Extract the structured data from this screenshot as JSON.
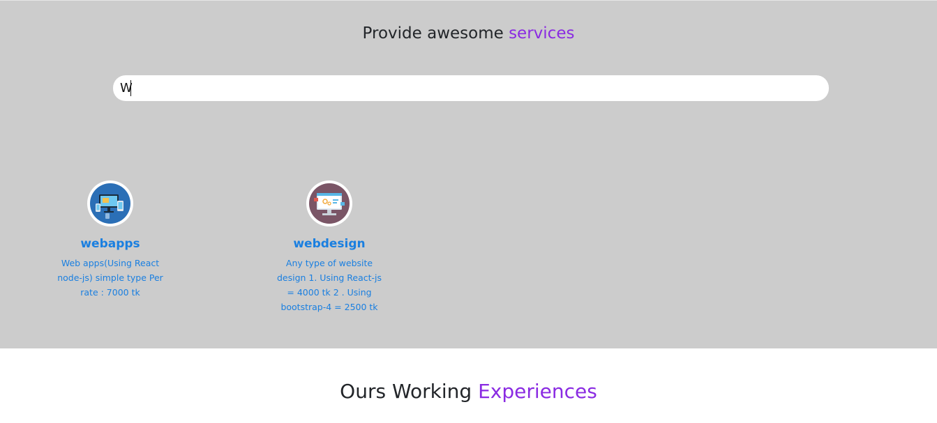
{
  "services": {
    "title_prefix": "Provide awesome",
    "title_accent": "services",
    "search": {
      "value": "W",
      "placeholder": ""
    },
    "cards": [
      {
        "title": "webapps",
        "description": "Web apps(Using React node-js) simple type Per rate : 7000 tk",
        "icon": "web-apps-devices-icon"
      },
      {
        "title": "webdesign",
        "description": "Any type of website design 1. Using React-js = 4000 tk 2 . Using bootstrap-4 = 2500 tk",
        "icon": "web-design-monitor-icon"
      }
    ]
  },
  "experiences": {
    "title_prefix": "Ours Working",
    "title_accent": "Experiences"
  },
  "colors": {
    "section_bg": "#cccccc",
    "accent": "#8a2be2",
    "link_blue": "#1a7fe0"
  }
}
